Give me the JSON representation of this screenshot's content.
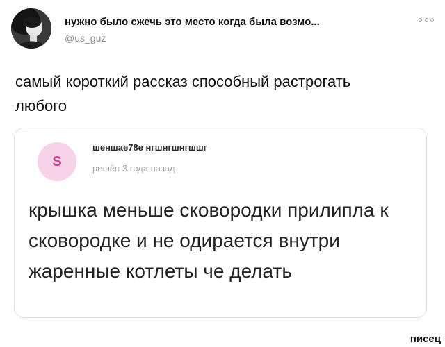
{
  "tweet": {
    "author_name": "нужно было сжечь это место когда была возмо...",
    "author_handle": "@us_guz",
    "more_icon": "ellipsis-icon",
    "text": "самый короткий рассказ способный растрогать любого"
  },
  "quote": {
    "avatar_letter": "S",
    "avatar_bg_color": "#f7d3e7",
    "avatar_fg_color": "#d43f8f",
    "username": "шеншае78е нгшнгшнгшшг",
    "meta": "решён 3 года назад",
    "body": "крышка меньше сковородки прилипла к сковородке и не одирается внутри жаренные котлеты че делать"
  },
  "watermark": "писец"
}
